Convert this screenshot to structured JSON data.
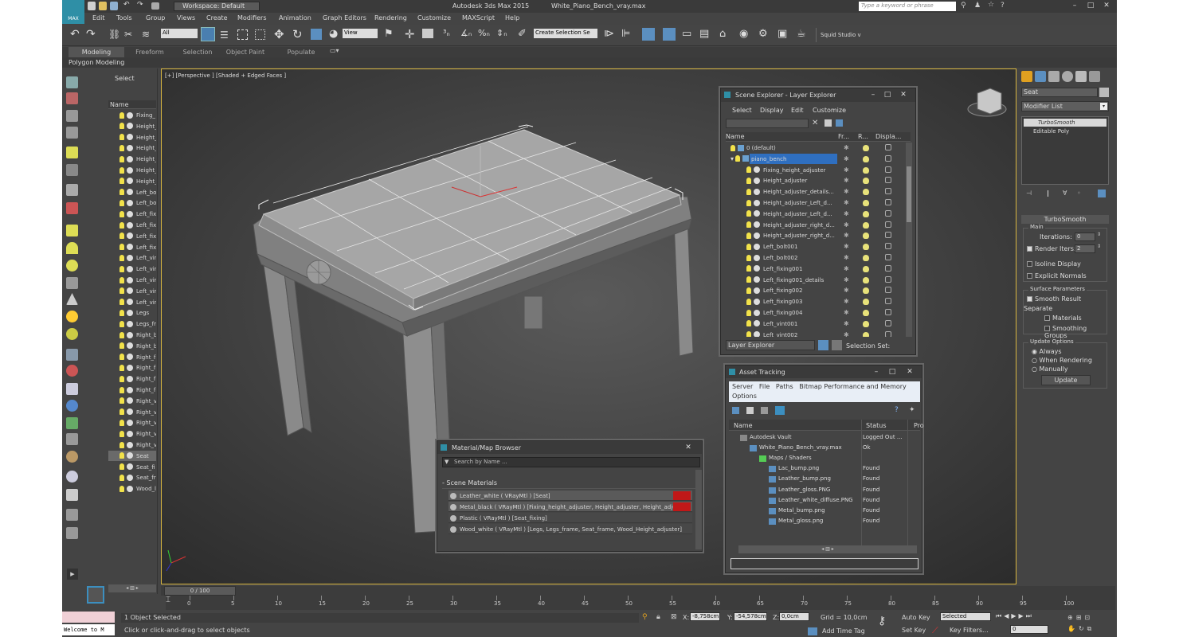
{
  "titlebar": {
    "app_title": "Autodesk 3ds Max  2015",
    "file_title": "White_Piano_Bench_vray.max",
    "workspace": "Workspace: Default",
    "search_placeholder": "Type a keyword or phrase"
  },
  "menu": [
    "Edit",
    "Tools",
    "Group",
    "Views",
    "Create",
    "Modifiers",
    "Animation",
    "Graph Editors",
    "Rendering",
    "Customize",
    "MAXScript",
    "Help"
  ],
  "toolbar": {
    "filter": "All",
    "view": "View",
    "selection_set": "Create Selection Se",
    "studio": "Squid Studio v"
  },
  "ribbon": {
    "tabs": [
      "Modeling",
      "Freeform",
      "Selection",
      "Object Paint",
      "Populate"
    ],
    "sub": "Polygon Modeling"
  },
  "left_list": {
    "header": "Select",
    "col": "Name",
    "items": [
      "Fixing_",
      "Height_",
      "Height_",
      "Height_",
      "Height_",
      "Height_",
      "Height_",
      "Left_bo",
      "Left_bo",
      "Left_fix",
      "Left_fix",
      "Left_fix",
      "Left_fix",
      "Left_vir",
      "Left_vir",
      "Left_vir",
      "Left_vir",
      "Left_vir",
      "Legs",
      "Legs_fr",
      "Right_b",
      "Right_b",
      "Right_f",
      "Right_f",
      "Right_f",
      "Right_f",
      "Right_v",
      "Right_v",
      "Right_v",
      "Right_v",
      "Right_v",
      "Seat",
      "Seat_fi",
      "Seat_fr",
      "Wood_l"
    ],
    "selected_index": 31
  },
  "viewport": {
    "label": "[+] [Perspective ] [Shaded + Edged Faces ]"
  },
  "scene_explorer": {
    "title": "Scene Explorer - Layer Explorer",
    "menu": [
      "Select",
      "Display",
      "Edit",
      "Customize"
    ],
    "cols": [
      "Name",
      "Fr...",
      "R...",
      "Displa..."
    ],
    "rows": [
      {
        "name": "0 (default)",
        "level": 0,
        "layer": true
      },
      {
        "name": "piano_bench",
        "level": 0,
        "layer": true,
        "selected": true
      },
      {
        "name": "Fixing_height_adjuster",
        "level": 1
      },
      {
        "name": "Height_adjuster",
        "level": 1
      },
      {
        "name": "Height_adjuster_details...",
        "level": 1
      },
      {
        "name": "Height_adjuster_Left_d...",
        "level": 1
      },
      {
        "name": "Height_adjuster_Left_d...",
        "level": 1
      },
      {
        "name": "Height_adjuster_right_d...",
        "level": 1
      },
      {
        "name": "Height_adjuster_right_d...",
        "level": 1
      },
      {
        "name": "Left_bolt001",
        "level": 1
      },
      {
        "name": "Left_bolt002",
        "level": 1
      },
      {
        "name": "Left_fixing001",
        "level": 1
      },
      {
        "name": "Left_fixing001_details",
        "level": 1
      },
      {
        "name": "Left_fixing002",
        "level": 1
      },
      {
        "name": "Left_fixing003",
        "level": 1
      },
      {
        "name": "Left_fixing004",
        "level": 1
      },
      {
        "name": "Left_vint001",
        "level": 1
      },
      {
        "name": "Left_vint002",
        "level": 1
      }
    ],
    "footer_mode": "Layer Explorer",
    "footer_sel": "Selection Set:"
  },
  "asset_tracking": {
    "title": "Asset Tracking",
    "menu": "Server   File   Paths   Bitmap Performance and Memory",
    "menu2": "Options",
    "cols": [
      "Name",
      "Status",
      "Pro"
    ],
    "rows": [
      {
        "name": "Autodesk Vault",
        "status": "Logged Out ...",
        "level": 0
      },
      {
        "name": "White_Piano_Bench_vray.max",
        "status": "Ok",
        "level": 1
      },
      {
        "name": "Maps / Shaders",
        "status": "",
        "level": 2
      },
      {
        "name": "Lac_bump.png",
        "status": "Found",
        "level": 3
      },
      {
        "name": "Leather_bump.png",
        "status": "Found",
        "level": 3
      },
      {
        "name": "Leather_gloss.PNG",
        "status": "Found",
        "level": 3
      },
      {
        "name": "Leather_white_diffuse.PNG",
        "status": "Found",
        "level": 3
      },
      {
        "name": "Metal_bump.png",
        "status": "Found",
        "level": 3
      },
      {
        "name": "Metal_gloss.png",
        "status": "Found",
        "level": 3
      }
    ]
  },
  "material_browser": {
    "title": "Material/Map Browser",
    "search_placeholder": "Search by Name ...",
    "section": "- Scene Materials",
    "rows": [
      "Leather_white  ( VRayMtl )  [Seat]",
      "Metal_black  ( VRayMtl )  [Fixing_height_adjuster, Height_adjuster, Height_adjus...",
      "Plastic  ( VRayMtl )  [Seat_fixing]",
      "Wood_white  ( VRayMtl )  [Legs, Legs_frame, Seat_frame, Wood_Height_adjuster]"
    ]
  },
  "command_panel": {
    "name": "Seat",
    "modifier_list": "Modifier List",
    "stack": [
      "TurboSmooth",
      "Editable Poly"
    ],
    "rollout": "TurboSmooth",
    "main_label": "Main",
    "iterations_label": "Iterations:",
    "iterations": "0",
    "render_iters_label": "Render Iters:",
    "render_iters": "2",
    "isoline": "Isoline Display",
    "explicit": "Explicit Normals",
    "surface_label": "Surface Parameters",
    "smooth_result": "Smooth Result",
    "separate_label": "Separate",
    "materials": "Materials",
    "smoothing_groups": "Smoothing Groups",
    "update_label": "Update Options",
    "always": "Always",
    "when_rendering": "When Rendering",
    "manually": "Manually",
    "update_btn": "Update"
  },
  "timeline": {
    "frame": "0 / 100",
    "ticks": [
      "0",
      "5",
      "10",
      "15",
      "20",
      "25",
      "30",
      "35",
      "40",
      "45",
      "50",
      "55",
      "60",
      "65",
      "70",
      "75",
      "80",
      "85",
      "90",
      "95",
      "100"
    ]
  },
  "status": {
    "selected": "1 Object Selected",
    "prompt": "Click or click-and-drag to select objects",
    "welcome": "Welcome to M",
    "x_label": "X:",
    "x": "-8,758cm",
    "y_label": "Y:",
    "y": "-54,578cm",
    "z_label": "Z:",
    "z": "0,0cm",
    "grid": "Grid = 10,0cm",
    "autokey": "Auto Key",
    "autokey_val": "Selected",
    "setkey": "Set Key",
    "keyfilters": "Key Filters...",
    "addtime": "Add Time Tag",
    "frame": "0"
  }
}
